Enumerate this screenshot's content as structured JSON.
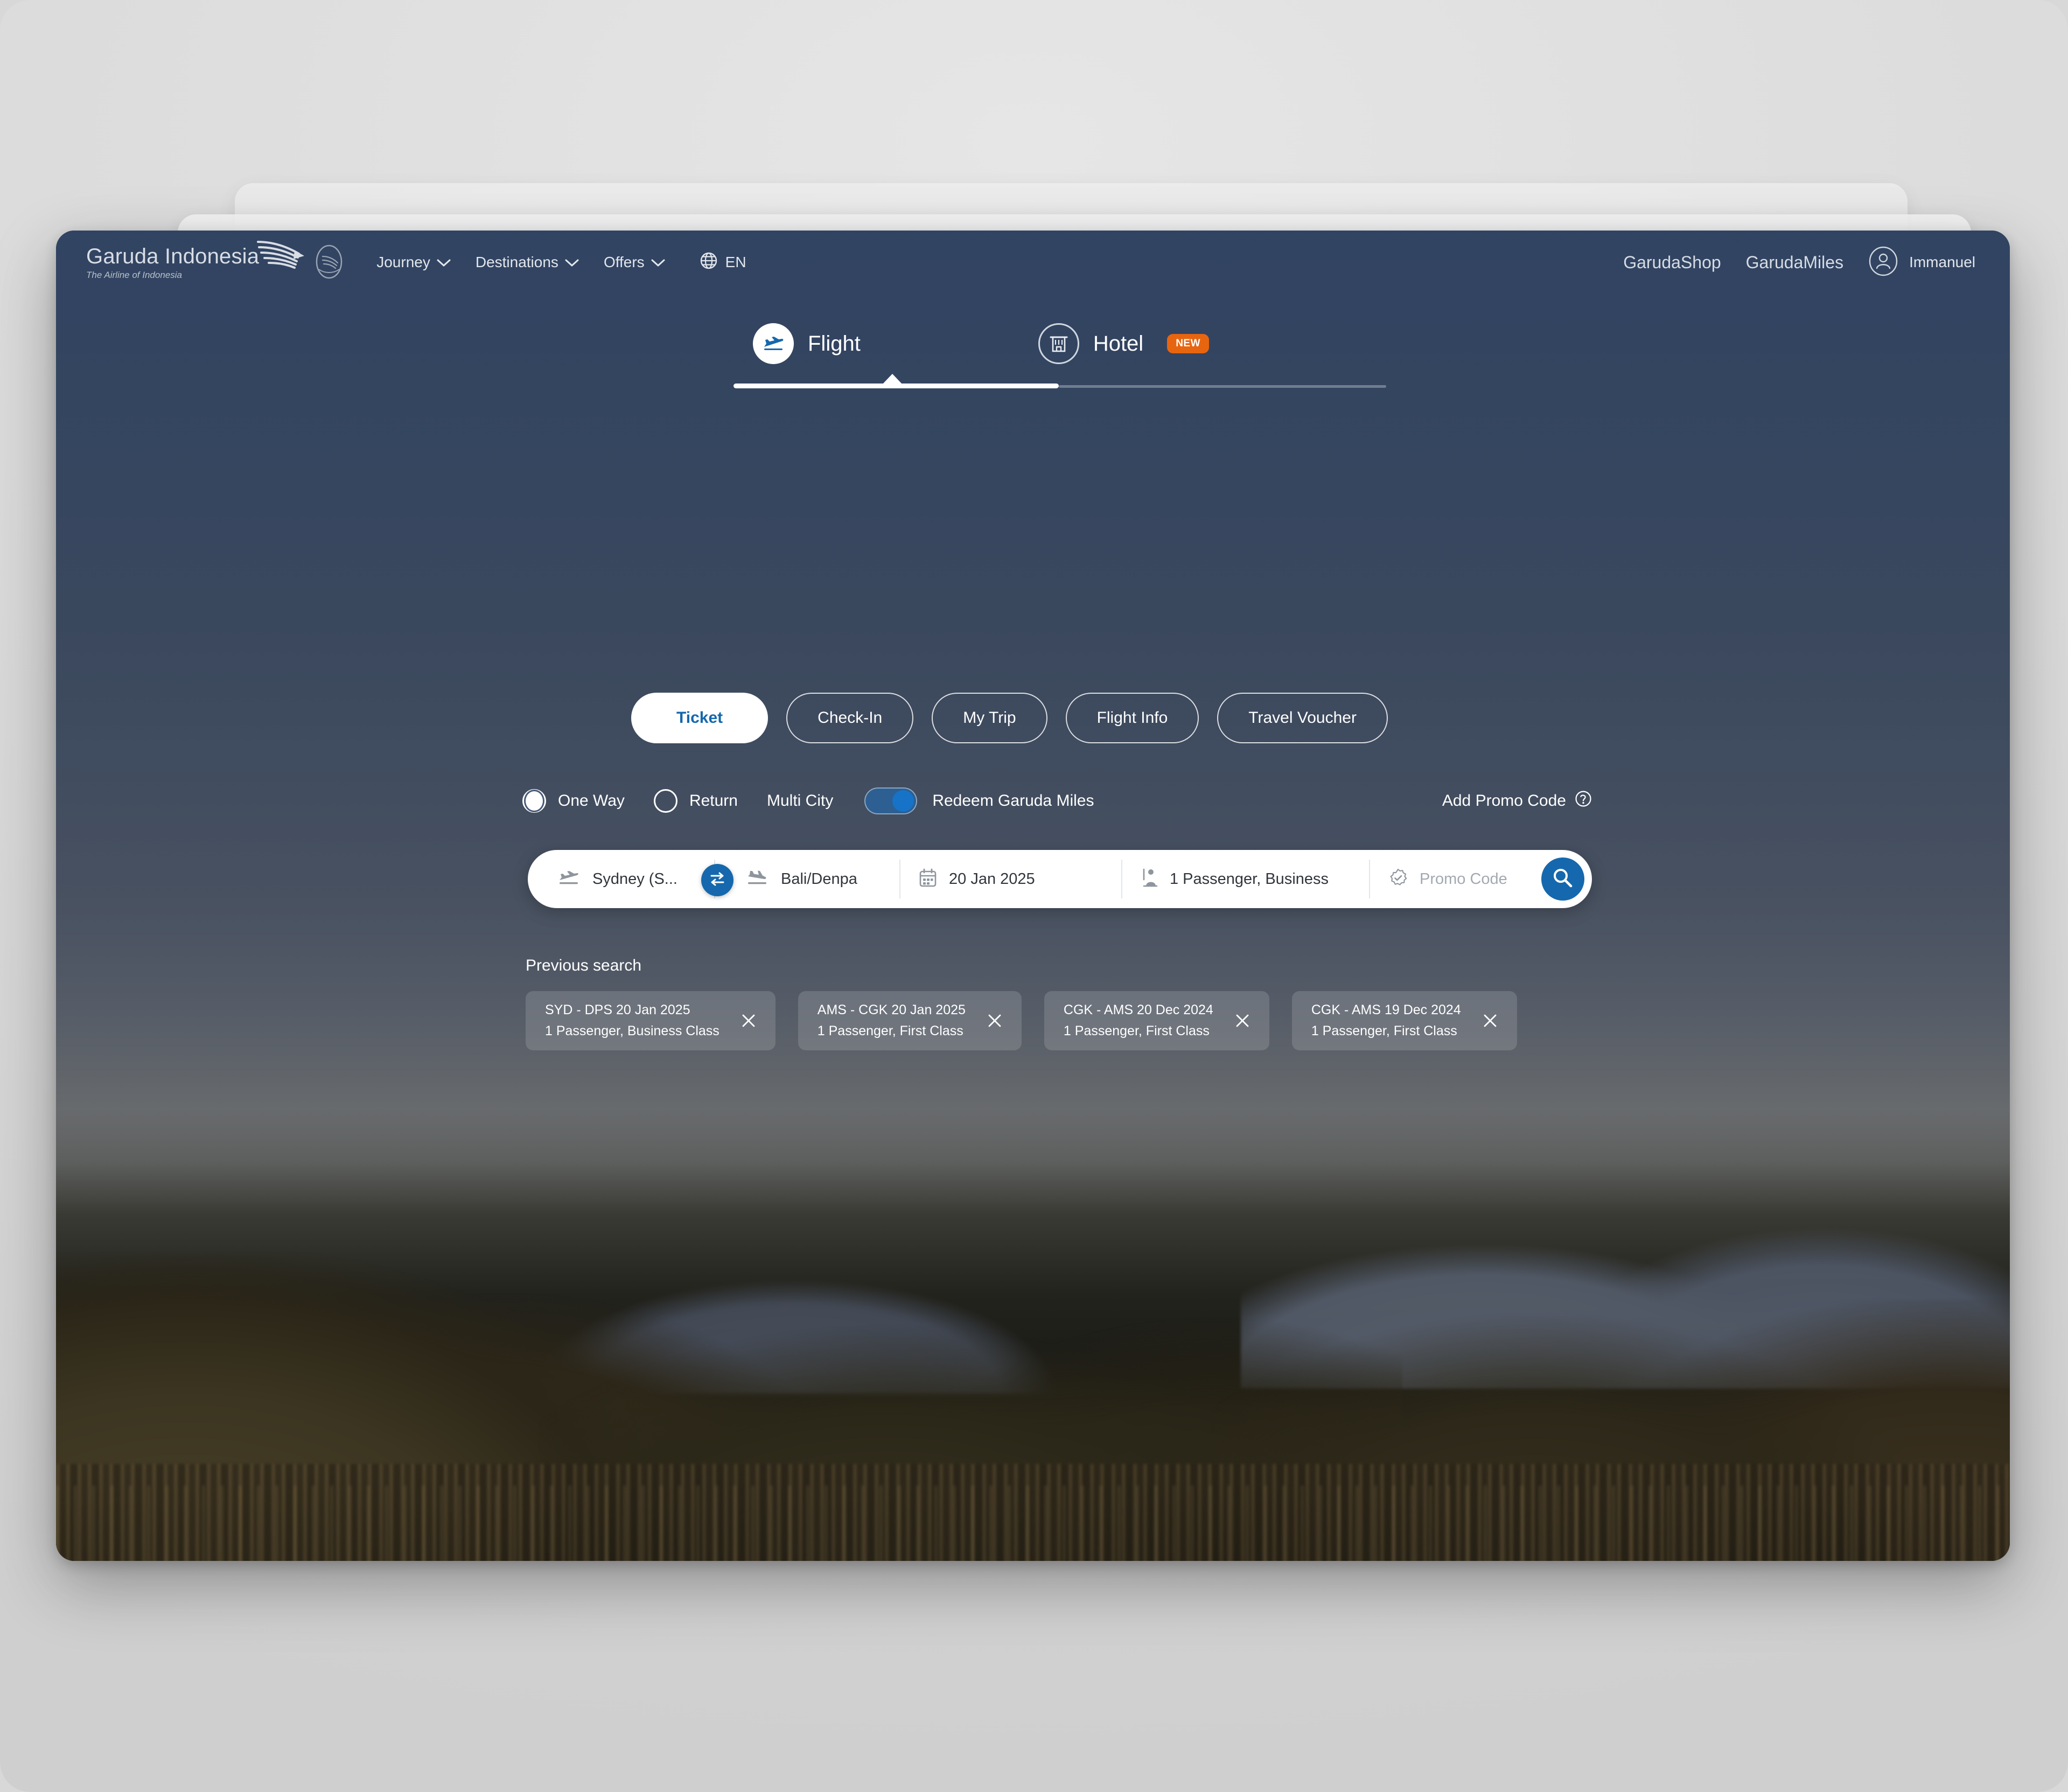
{
  "header": {
    "brand": {
      "name": "Garuda Indonesia",
      "tagline": "The Airline of Indonesia"
    },
    "nav": [
      {
        "label": "Journey",
        "icon": "chevron-down-icon"
      },
      {
        "label": "Destinations",
        "icon": "chevron-down-icon"
      },
      {
        "label": "Offers",
        "icon": "chevron-down-icon"
      }
    ],
    "language": {
      "label": "EN",
      "icon": "globe-icon"
    },
    "shop_link": "GarudaShop",
    "miles_link": "GarudaMiles",
    "account": {
      "name": "Immanuel",
      "icon": "user-avatar-icon"
    }
  },
  "product_tabs": [
    {
      "label": "Flight",
      "icon": "airplane-icon",
      "active": true,
      "badge": ""
    },
    {
      "label": "Hotel",
      "icon": "hotel-building-icon",
      "active": false,
      "badge": "NEW"
    }
  ],
  "pill_tabs": [
    {
      "label": "Ticket",
      "active": true
    },
    {
      "label": "Check-In",
      "active": false
    },
    {
      "label": "My Trip",
      "active": false
    },
    {
      "label": "Flight Info",
      "active": false
    },
    {
      "label": "Travel Voucher",
      "active": false
    }
  ],
  "trip_options": {
    "one_way": {
      "label": "One Way",
      "checked": true
    },
    "return": {
      "label": "Return",
      "checked": false
    },
    "multi_city": {
      "label": "Multi City"
    },
    "redeem_miles": {
      "label": "Redeem Garuda Miles",
      "on": true
    },
    "add_promo": {
      "label": "Add Promo Code",
      "icon": "help-circle-icon"
    }
  },
  "search_form": {
    "origin": {
      "value": "Sydney (S...",
      "icon": "plane-departure-icon"
    },
    "destination": {
      "value": "Bali/Denpa",
      "icon": "plane-arrival-icon"
    },
    "swap": {
      "icon": "swap-arrows-icon"
    },
    "date": {
      "value": "20 Jan 2025",
      "icon": "calendar-icon"
    },
    "passengers": {
      "value": "1 Passenger, Business",
      "icon": "passenger-icon"
    },
    "promo": {
      "placeholder": "Promo Code",
      "value": "",
      "icon": "promo-seal-icon"
    },
    "submit": {
      "icon": "search-icon"
    }
  },
  "previous_search": {
    "title": "Previous search",
    "items": [
      {
        "route": "SYD - DPS 20 Jan 2025",
        "detail": "1 Passenger, Business Class",
        "remove_icon": "close-icon"
      },
      {
        "route": "AMS - CGK 20 Jan 2025",
        "detail": "1 Passenger, First Class",
        "remove_icon": "close-icon"
      },
      {
        "route": "CGK - AMS 20 Dec 2024",
        "detail": "1 Passenger, First Class",
        "remove_icon": "close-icon"
      },
      {
        "route": "CGK - AMS 19 Dec 2024",
        "detail": "1 Passenger, First Class",
        "remove_icon": "close-icon"
      }
    ]
  },
  "colors": {
    "brand_blue": "#1568ad",
    "badge_orange": "#e8650f",
    "header_navy": "#2f4262",
    "white": "#ffffff"
  }
}
